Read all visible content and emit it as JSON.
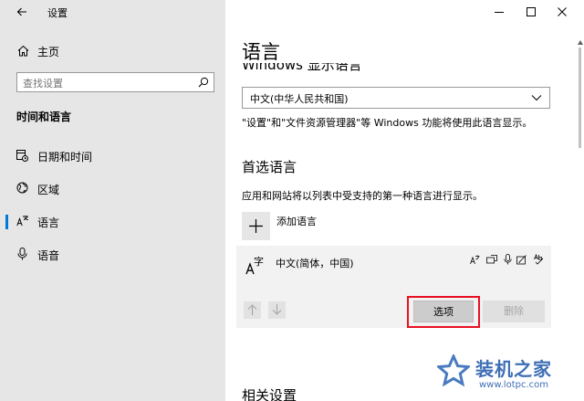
{
  "window": {
    "title": "设置",
    "controls": {
      "minimize": "minimize-icon",
      "maximize": "maximize-icon",
      "close": "close-icon"
    }
  },
  "sidebar": {
    "home_label": "主页",
    "search_placeholder": "查找设置",
    "section_title": "时间和语言",
    "items": [
      {
        "label": "日期和时间",
        "icon": "clock-calendar-icon"
      },
      {
        "label": "区域",
        "icon": "globe-icon"
      },
      {
        "label": "语言",
        "icon": "language-icon",
        "selected": true
      },
      {
        "label": "语音",
        "icon": "microphone-icon"
      }
    ]
  },
  "main": {
    "page_title": "语言",
    "display_language_heading": "Windows 显示语言",
    "display_language_value": "中文(中华人民共和国)",
    "display_language_note": "\"设置\"和\"文件资源管理器\"等 Windows 功能将使用此语言显示。",
    "preferred_heading": "首选语言",
    "preferred_note": "应用和网站将以列表中受支持的第一种语言进行显示。",
    "add_language_label": "添加语言",
    "language_item": {
      "name": "中文(简体，中国)",
      "feature_icons": [
        "text-to-speech-icon",
        "display-language-icon",
        "speech-icon",
        "handwriting-icon",
        "spell-check-icon"
      ],
      "options_label": "选项",
      "remove_label": "删除"
    },
    "related_heading": "相关设置"
  },
  "watermark": {
    "text": "装机之家",
    "url": "www.lotpc.com"
  },
  "colors": {
    "accent": "#0078d7",
    "sidebar_bg": "#e6e6e6",
    "highlight": "#e81123"
  }
}
